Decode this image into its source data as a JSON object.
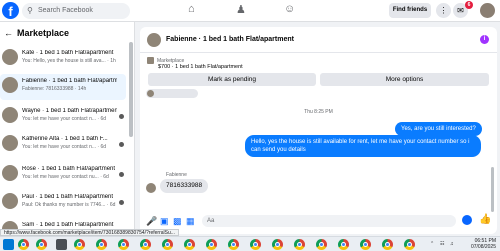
{
  "topbar": {
    "search_placeholder": "Search Facebook",
    "find_friends_label": "Find friends",
    "notification_count": "6"
  },
  "sidebar": {
    "title": "Marketplace",
    "items": [
      {
        "title": "Kate · 1 bed 1 bath Flat/apartment",
        "subtitle": "You: Hello, yes the house is still ava... · 1h"
      },
      {
        "title": "Fabienne · 1 bed 1 bath Flat/apartment",
        "subtitle": "Fabienne: 7816333988 · 14h"
      },
      {
        "title": "Wayne · 1 bed 1 bath Flat/apartment",
        "subtitle": "You: let me have your contact n... · 6d"
      },
      {
        "title": "Katherine Alta · 1 bed 1 bath F...",
        "subtitle": "You: let me have your contact n... · 6d"
      },
      {
        "title": "Rose · 1 bed 1 bath Flat/apartment",
        "subtitle": "You: let me have your contact nu... · 6d"
      },
      {
        "title": "Paul · 1 bed 1 bath Flat/apartment",
        "subtitle": "Paul: Ok thanks my number is 7746... · 6d"
      },
      {
        "title": "Sam · 1 bed 1 bath Flat/apartment",
        "subtitle": ""
      }
    ]
  },
  "chat": {
    "title": "Fabienne · 1 bed 1 bath Flat/apartment",
    "listing_label": "Marketplace",
    "listing_price": "$700 · 1 bed 1 bath Flat/apartment",
    "mark_pending_label": "Mark as pending",
    "more_options_label": "More options",
    "timestamp": "Thu 8:25 PM",
    "out_message_1": "Yes, are you still interested?",
    "out_message_2": "Hello, yes the house is still available for rent, let me have your contact number so i can send you details",
    "in_sender": "Fabienne",
    "in_message": "7816333988",
    "composer_placeholder": "Aa"
  },
  "status_url": "https://www.facebook.com/marketplace/item/730168389830754/?referralSu...",
  "taskbar": {
    "time": "06:51 PM",
    "date": "07/08/2025"
  },
  "colors": {
    "brand": "#0866ff",
    "outgoing_bubble": "#0a7cff",
    "badge": "#e41e3f",
    "info_icon": "#a033ff"
  }
}
